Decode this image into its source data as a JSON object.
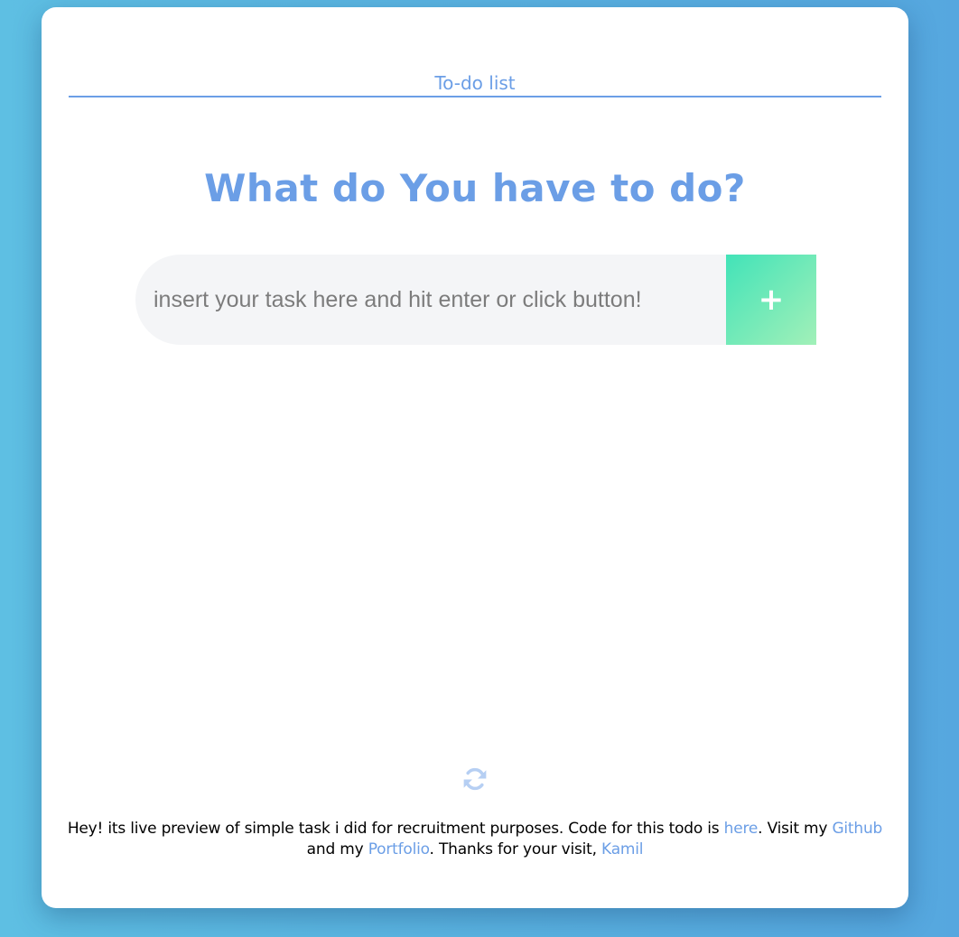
{
  "header": {
    "title": "To-do list"
  },
  "main": {
    "question": "What do You have to do?",
    "task_input": {
      "value": "",
      "placeholder": "insert your task here and hit enter or click button!"
    },
    "add_button_label": "+",
    "refresh_icon": "refresh-icon"
  },
  "footer": {
    "text_1": "Hey! its live preview of simple task i did for recruitment purposes. Code for this todo is ",
    "link_here": "here",
    "text_2": ". Visit my ",
    "link_github": "Github",
    "text_3": " and my ",
    "link_portfolio": "Portfolio",
    "text_4": ". Thanks for your visit, ",
    "link_kamil": "Kamil"
  },
  "colors": {
    "accent": "#6b9ee6",
    "button_gradient_start": "#42e3b8",
    "button_gradient_end": "#a2f0b8",
    "background_start": "#5ebfe3",
    "background_end": "#56a7df"
  }
}
